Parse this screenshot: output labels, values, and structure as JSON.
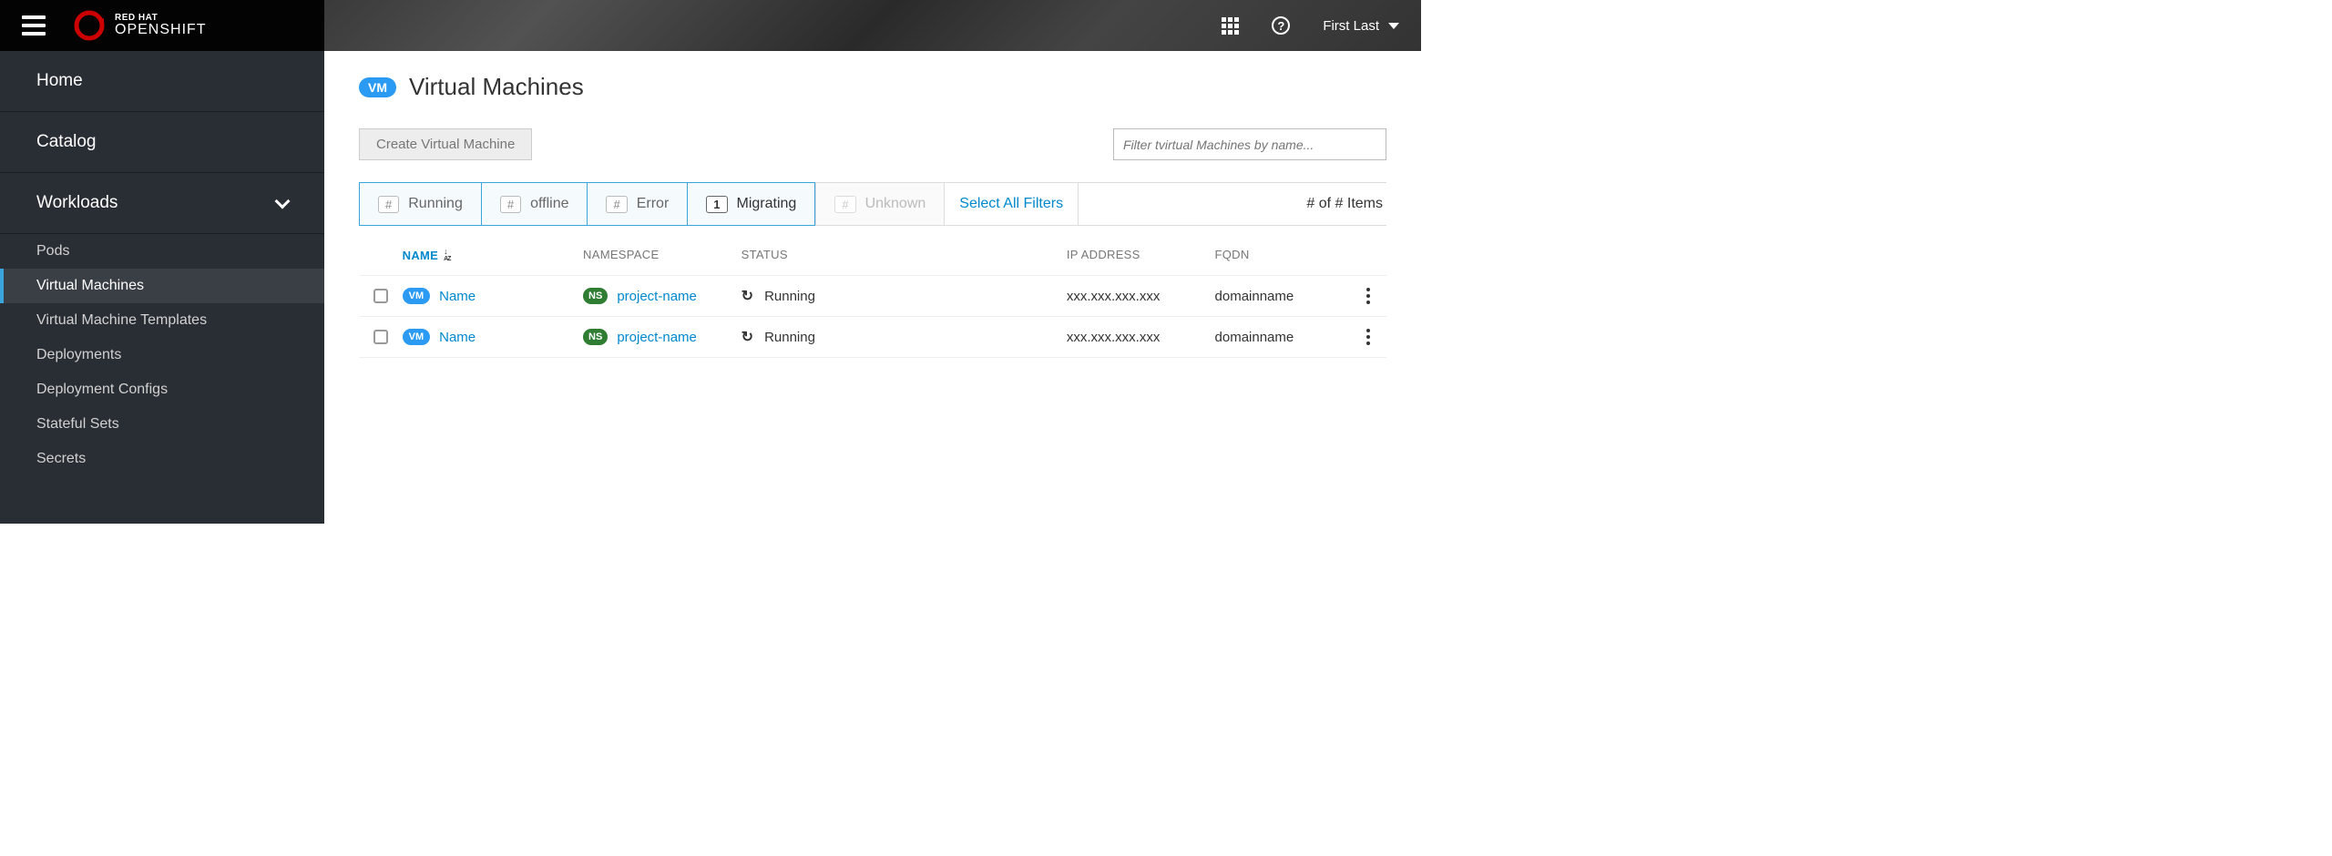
{
  "header": {
    "brand_top": "RED HAT",
    "brand_bottom": "OPENSHIFT",
    "user_name": "First Last"
  },
  "sidebar": {
    "home": "Home",
    "catalog": "Catalog",
    "workloads": "Workloads",
    "items": [
      "Pods",
      "Virtual Machines",
      "Virtual Machine Templates",
      "Deployments",
      "Deployment Configs",
      "Stateful Sets",
      "Secrets"
    ]
  },
  "page": {
    "badge": "VM",
    "title": "Virtual Machines",
    "create_btn": "Create Virtual Machine",
    "filter_placeholder": "Filter tvirtual Machines by name..."
  },
  "filters": {
    "running": {
      "count": "#",
      "label": "Running"
    },
    "offline": {
      "count": "#",
      "label": "offline"
    },
    "error": {
      "count": "#",
      "label": "Error"
    },
    "migrating": {
      "count": "1",
      "label": "Migrating"
    },
    "unknown": {
      "count": "#",
      "label": "Unknown"
    },
    "select_all": "Select All Filters",
    "items_count": "# of # Items"
  },
  "table": {
    "headers": {
      "name": "NAME",
      "namespace": "NAMESPACE",
      "status": "STATUS",
      "ip": "IP ADDRESS",
      "fqdn": "FQDN"
    },
    "rows": [
      {
        "vm_badge": "VM",
        "name": "Name",
        "ns_badge": "NS",
        "namespace": "project-name",
        "status": "Running",
        "ip": "xxx.xxx.xxx.xxx",
        "fqdn": "domainname"
      },
      {
        "vm_badge": "VM",
        "name": "Name",
        "ns_badge": "NS",
        "namespace": "project-name",
        "status": "Running",
        "ip": "xxx.xxx.xxx.xxx",
        "fqdn": "domainname"
      }
    ]
  }
}
